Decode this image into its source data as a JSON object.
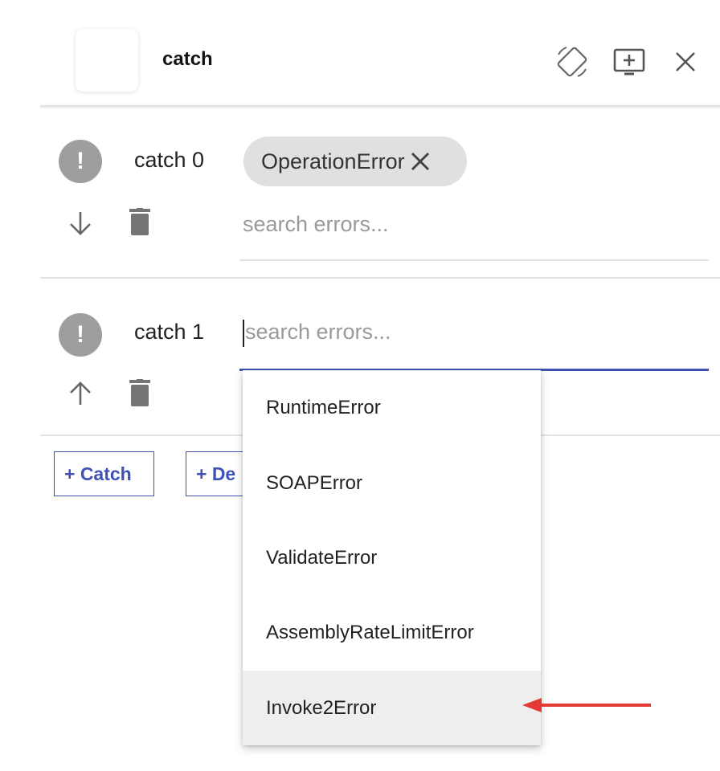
{
  "header": {
    "title": "catch",
    "icons": [
      "rotate-icon",
      "add-to-screen-icon",
      "close-icon"
    ]
  },
  "catches": [
    {
      "label": "catch 0",
      "selected_error": "OperationError",
      "search_placeholder": "search errors...",
      "move_icon": "arrow-down-icon"
    },
    {
      "label": "catch 1",
      "search_placeholder": "search errors...",
      "move_icon": "arrow-up-icon"
    }
  ],
  "buttons": {
    "add_catch": "+ Catch",
    "add_default": "+ De"
  },
  "dropdown": {
    "options": [
      "RuntimeError",
      "SOAPError",
      "ValidateError",
      "AssemblyRateLimitError",
      "Invoke2Error"
    ],
    "highlighted": "Invoke2Error"
  },
  "colors": {
    "accent": "#3f51b5",
    "annotation_arrow": "#e53935",
    "warning_icon": "#9e9e9e",
    "chip_bg": "#e0e0e0"
  }
}
